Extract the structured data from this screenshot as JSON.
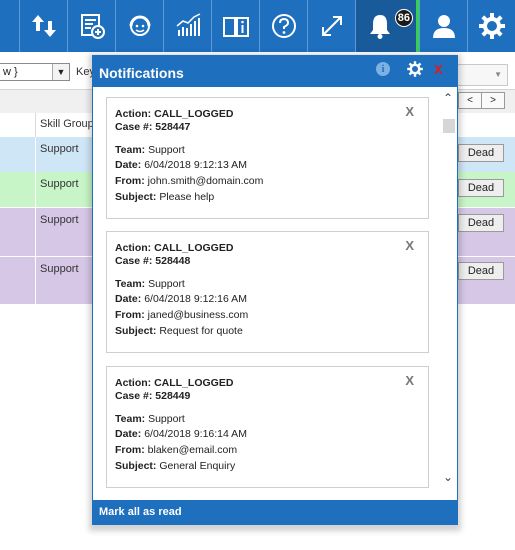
{
  "toolbar": {
    "badge_count": "86"
  },
  "filter": {
    "combo_value": "w }",
    "label": "Key"
  },
  "grid": {
    "pager_prev": "<",
    "pager_next": ">",
    "column_header": "Skill Group",
    "rows": [
      {
        "value": "Support",
        "button": "Dead",
        "color": "#cfe6f7"
      },
      {
        "value": "Support",
        "button": "Dead",
        "color": "#c7f5c7"
      },
      {
        "value": "Support",
        "button": "Dead",
        "color": "#d6c7e6"
      },
      {
        "value": "Support",
        "button": "Dead",
        "color": "#d6c7e6"
      }
    ]
  },
  "notifications": {
    "title": "Notifications",
    "info_glyph": "i",
    "close_glyph": "X",
    "mark_all_label": "Mark all as read",
    "labels": {
      "action": "Action:",
      "case": "Case #:",
      "team": "Team:",
      "date": "Date:",
      "from": "From:",
      "subject": "Subject:"
    },
    "items": [
      {
        "dismiss": "X",
        "action": "CALL_LOGGED",
        "case": "528447",
        "team": "Support",
        "date": "6/04/2018 9:12:13 AM",
        "from": "john.smith@domain.com",
        "subject": "Please help"
      },
      {
        "dismiss": "X",
        "action": "CALL_LOGGED",
        "case": "528448",
        "team": "Support",
        "date": "6/04/2018 9:12:16 AM",
        "from": "janed@business.com",
        "subject": "Request for quote"
      },
      {
        "dismiss": "X",
        "action": "CALL_LOGGED",
        "case": "528449",
        "team": "Support",
        "date": "6/04/2018 9:16:14 AM",
        "from": "blaken@email.com",
        "subject": "General Enquiry"
      }
    ]
  },
  "colors": {
    "brand_blue": "#1e6fbd",
    "close_red": "#e01b1b",
    "active_green": "#36d14a"
  }
}
